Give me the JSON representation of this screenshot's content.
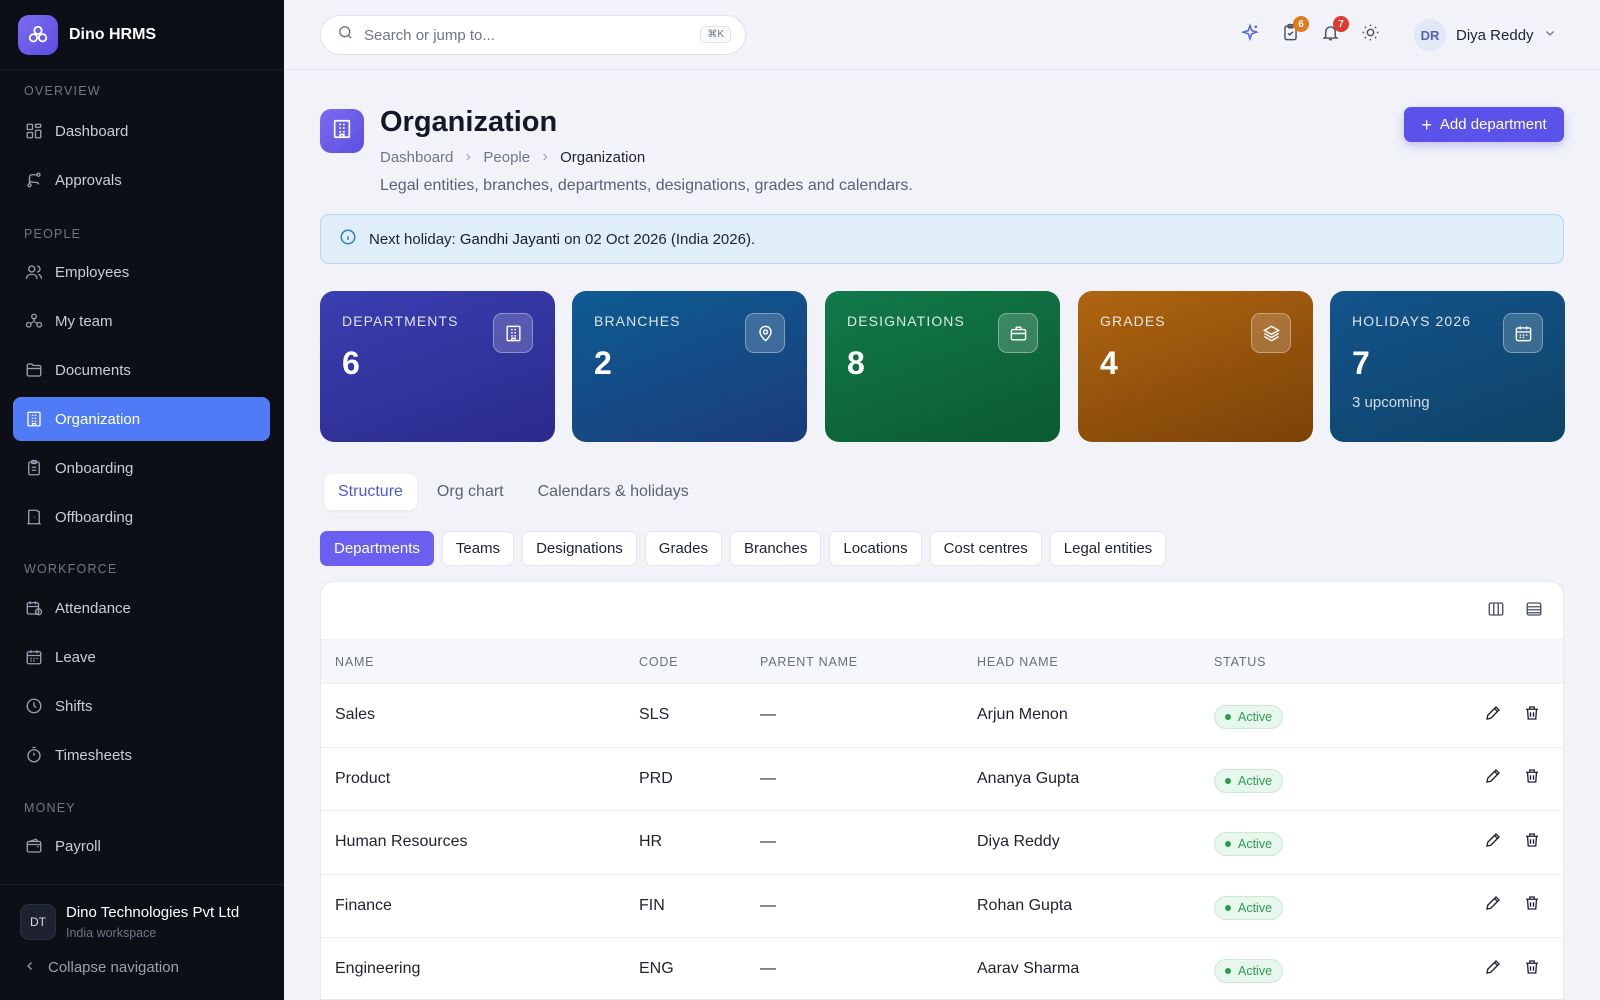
{
  "app": {
    "name": "Dino HRMS"
  },
  "sidebar": {
    "sections": [
      "OVERVIEW",
      "PEOPLE",
      "WORKFORCE",
      "MONEY"
    ],
    "items": [
      {
        "label": "Dashboard",
        "icon": "dashboard-icon"
      },
      {
        "label": "Approvals",
        "icon": "approvals-icon"
      },
      {
        "label": "Employees",
        "icon": "users-icon"
      },
      {
        "label": "My team",
        "icon": "team-icon"
      },
      {
        "label": "Documents",
        "icon": "folder-icon"
      },
      {
        "label": "Organization",
        "icon": "building-icon",
        "active": true
      },
      {
        "label": "Onboarding",
        "icon": "clipboard-icon"
      },
      {
        "label": "Offboarding",
        "icon": "door-icon"
      },
      {
        "label": "Attendance",
        "icon": "calendar-clock-icon"
      },
      {
        "label": "Leave",
        "icon": "calendar-icon"
      },
      {
        "label": "Shifts",
        "icon": "clock-icon"
      },
      {
        "label": "Timesheets",
        "icon": "stopwatch-icon"
      },
      {
        "label": "Payroll",
        "icon": "wallet-icon"
      }
    ],
    "org": {
      "initials": "DT",
      "name": "Dino Technologies Pvt Ltd",
      "subtitle": "India workspace"
    },
    "collapse_label": "Collapse navigation"
  },
  "topbar": {
    "search_placeholder": "Search or jump to...",
    "search_shortcut": "⌘K",
    "tasks_badge": "6",
    "notifications_badge": "7",
    "user": {
      "initials": "DR",
      "name": "Diya Reddy"
    }
  },
  "header": {
    "title": "Organization",
    "breadcrumb": [
      "Dashboard",
      "People",
      "Organization"
    ],
    "description": "Legal entities, branches, departments, designations, grades and calendars.",
    "add_button": "Add department"
  },
  "banner": {
    "prefix": "Next holiday:",
    "holiday": "Gandhi Jayanti",
    "suffix": "on 02 Oct 2026 (India 2026)."
  },
  "stats": [
    {
      "label": "DEPARTMENTS",
      "value": "6",
      "sub": "",
      "icon": "building-icon",
      "color_from": "#3a3fb0",
      "color_to": "#2b2a8c"
    },
    {
      "label": "BRANCHES",
      "value": "2",
      "sub": "",
      "icon": "location-pin-icon",
      "color_from": "#0d5c92",
      "color_to": "#1b3c7a"
    },
    {
      "label": "DESIGNATIONS",
      "value": "8",
      "sub": "",
      "icon": "briefcase-icon",
      "color_from": "#117a4a",
      "color_to": "#0b5a2f"
    },
    {
      "label": "GRADES",
      "value": "4",
      "sub": "",
      "icon": "layers-icon",
      "color_from": "#b06510",
      "color_to": "#7a4208"
    },
    {
      "label": "HOLIDAYS 2026",
      "value": "7",
      "sub": "3 upcoming",
      "icon": "calendar-icon",
      "color_from": "#13548c",
      "color_to": "#0e4366"
    }
  ],
  "tabs": [
    {
      "label": "Structure",
      "active": true
    },
    {
      "label": "Org chart",
      "active": false
    },
    {
      "label": "Calendars & holidays",
      "active": false
    }
  ],
  "subtabs": [
    {
      "label": "Departments",
      "active": true
    },
    {
      "label": "Teams",
      "active": false
    },
    {
      "label": "Designations",
      "active": false
    },
    {
      "label": "Grades",
      "active": false
    },
    {
      "label": "Branches",
      "active": false
    },
    {
      "label": "Locations",
      "active": false
    },
    {
      "label": "Cost centres",
      "active": false
    },
    {
      "label": "Legal entities",
      "active": false
    }
  ],
  "table": {
    "columns": [
      "NAME",
      "CODE",
      "PARENT NAME",
      "HEAD NAME",
      "STATUS"
    ],
    "rows": [
      {
        "name": "Sales",
        "code": "SLS",
        "parent": "—",
        "head": "Arjun Menon",
        "status": "Active"
      },
      {
        "name": "Product",
        "code": "PRD",
        "parent": "—",
        "head": "Ananya Gupta",
        "status": "Active"
      },
      {
        "name": "Human Resources",
        "code": "HR",
        "parent": "—",
        "head": "Diya Reddy",
        "status": "Active"
      },
      {
        "name": "Finance",
        "code": "FIN",
        "parent": "—",
        "head": "Rohan Gupta",
        "status": "Active"
      },
      {
        "name": "Engineering",
        "code": "ENG",
        "parent": "—",
        "head": "Aarav Sharma",
        "status": "Active"
      }
    ]
  },
  "colors": {
    "accent": "#5b52ea",
    "sidebar_bg": "#0d0f16",
    "active_nav": "#4f7cf6",
    "status_green": "#2f9a54"
  }
}
